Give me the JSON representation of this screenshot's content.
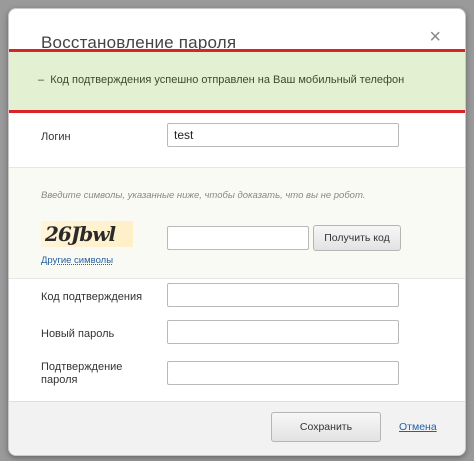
{
  "dialog": {
    "title": "Восстановление пароля",
    "close_glyph": "×"
  },
  "alert": {
    "icon_glyph": "–",
    "message": "Код подтверждения успешно отправлен на Ваш мобильный телефон"
  },
  "login": {
    "label": "Логин",
    "value": "test"
  },
  "captcha": {
    "hint": "Введите символы, указанные ниже, чтобы доказать, что вы не робот.",
    "image_text": "26Jbwl",
    "other_symbols_link": "Другие символы",
    "input_value": "",
    "get_code_button": "Получить код"
  },
  "fields": {
    "confirmation_code_label": "Код подтверждения",
    "new_password_label": "Новый пароль",
    "confirm_password_label": "Подтверждение пароля"
  },
  "footer": {
    "save_button": "Сохранить",
    "cancel_link": "Отмена"
  }
}
